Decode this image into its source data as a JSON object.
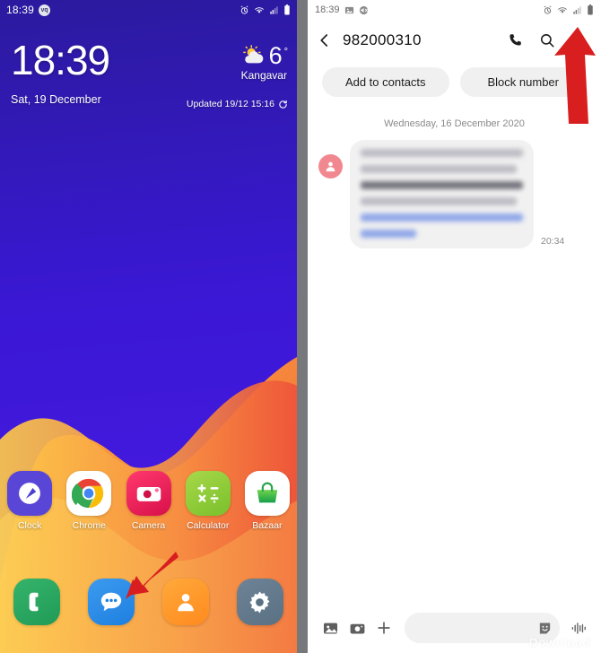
{
  "home_screen": {
    "status_bar": {
      "time": "18:39",
      "notification_badge": "vq",
      "icons": [
        "alarm-icon",
        "wifi-icon",
        "signal-icon",
        "battery-icon"
      ]
    },
    "clock_widget": {
      "time": "18:39",
      "date": "Sat, 19 December"
    },
    "weather_widget": {
      "temperature": "6",
      "degree_symbol": "°",
      "city": "Kangavar",
      "updated": "Updated 19/12 15:16",
      "icon": "sun-behind-cloud-icon",
      "refresh_icon": "refresh-icon"
    },
    "apps": [
      {
        "label": "Clock",
        "icon": "clock-app-icon"
      },
      {
        "label": "Chrome",
        "icon": "chrome-app-icon"
      },
      {
        "label": "Camera",
        "icon": "camera-app-icon"
      },
      {
        "label": "Calculator",
        "icon": "calculator-app-icon"
      },
      {
        "label": "Bazaar",
        "icon": "bazaar-app-icon"
      }
    ],
    "dock": [
      {
        "name": "phone",
        "icon": "phone-handset-icon"
      },
      {
        "name": "messages",
        "icon": "message-bubble-icon"
      },
      {
        "name": "contacts",
        "icon": "person-icon"
      },
      {
        "name": "settings",
        "icon": "gear-icon"
      }
    ],
    "annotation_arrow": "red-arrow-pointing-to-messages-app"
  },
  "messages_screen": {
    "status_bar": {
      "time": "18:39",
      "left_icons": [
        "image-icon",
        "mute-icon"
      ],
      "right_icons": [
        "alarm-icon",
        "wifi-icon",
        "signal-icon",
        "battery-icon"
      ]
    },
    "header": {
      "back_icon": "back-chevron-icon",
      "title": "982000310",
      "call_icon": "phone-call-icon",
      "search_icon": "search-icon",
      "menu_icon": "more-vertical-icon"
    },
    "chips": [
      {
        "label": "Add to contacts"
      },
      {
        "label": "Block number"
      }
    ],
    "conversation": {
      "day_label": "Wednesday, 16 December 2020",
      "messages": [
        {
          "sender": "incoming",
          "avatar_icon": "person-avatar-icon",
          "body_redacted": true,
          "time": "20:34"
        }
      ]
    },
    "compose_bar": {
      "gallery_icon": "image-icon",
      "camera_icon": "camera-icon",
      "add_icon": "plus-icon",
      "input_placeholder": "",
      "sticker_icon": "sticker-smiley-icon",
      "voice_icon": "audio-waveform-icon"
    },
    "watermark": "Download",
    "annotation_arrow": "red-arrow-pointing-to-more-options-menu"
  },
  "colors": {
    "wallpaper_purple": "#4b1ae8",
    "wallpaper_orange": "#f5813c",
    "wallpaper_yellow": "#fbbc3c",
    "accent_red_arrow": "#dc1f1f",
    "chip_gray": "#f0f0f0",
    "bubble_gray": "#f1f1f1",
    "avatar_pink": "#f2888f"
  }
}
